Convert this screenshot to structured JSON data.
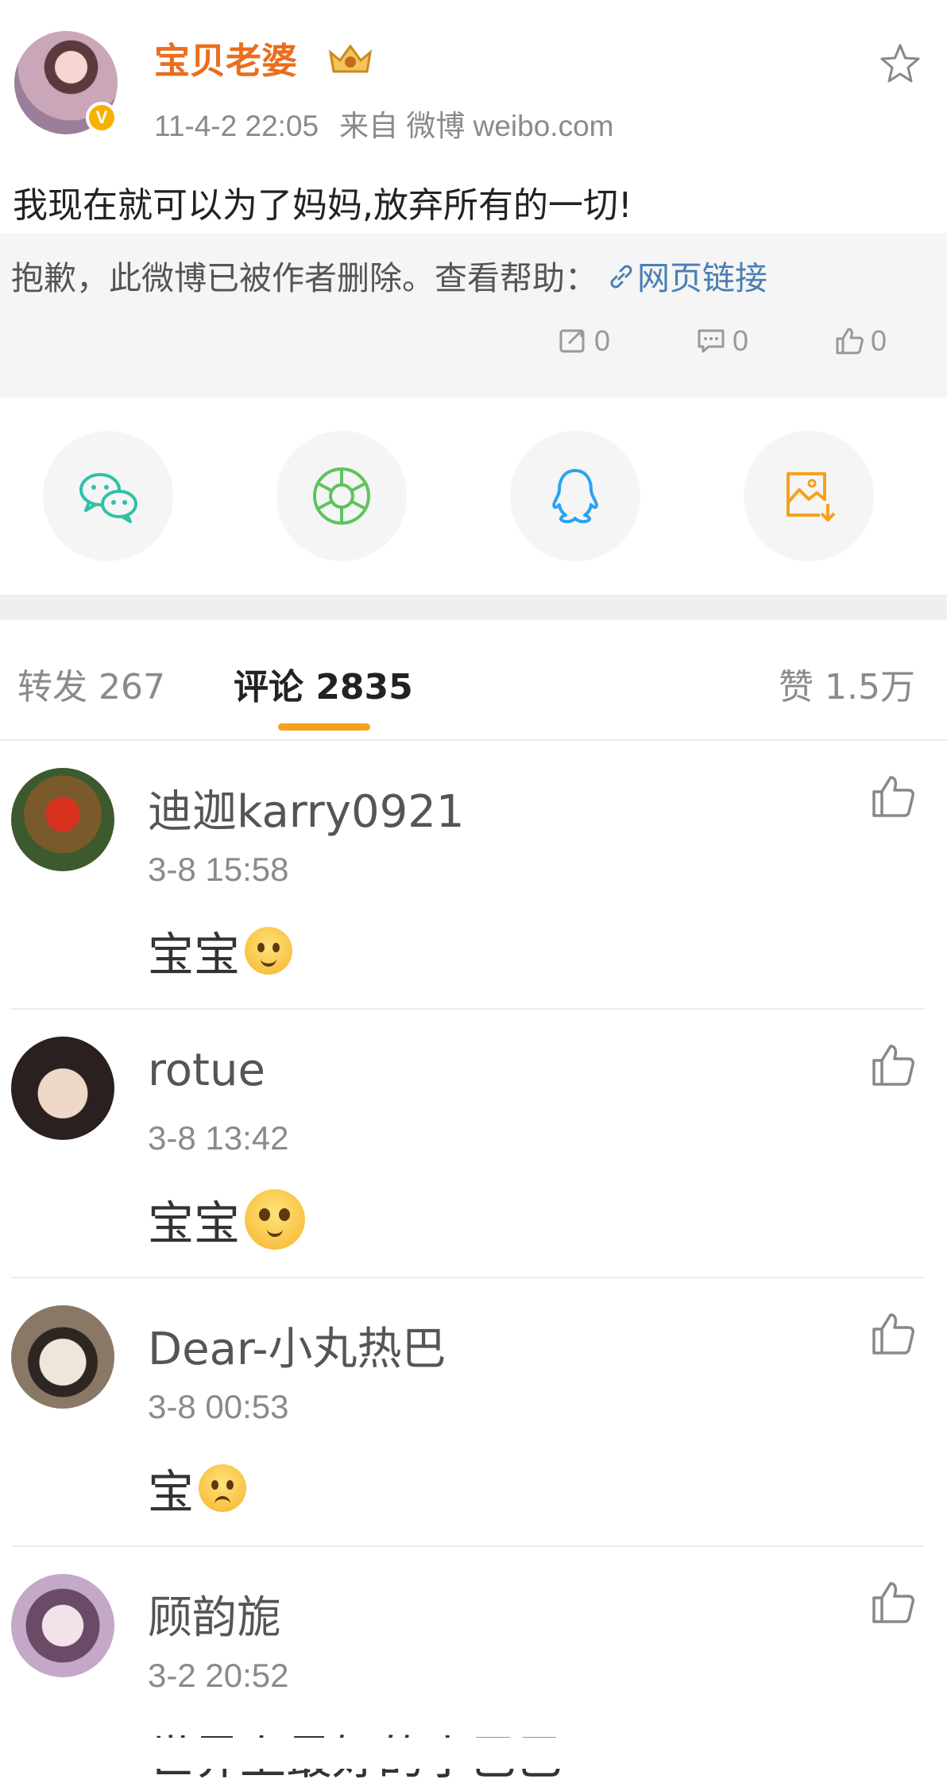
{
  "post": {
    "username": "宝贝老婆",
    "time": "11-4-2 22:05",
    "source": "来自 微博 weibo.com",
    "text": "我现在就可以为了妈妈,放弃所有的一切!",
    "deleted_notice": "抱歉，此微博已被作者删除。查看帮助：",
    "web_link": "网页链接",
    "repost_count": "0",
    "comment_count": "0",
    "like_count": "0"
  },
  "share": {
    "icons": [
      "wechat-icon",
      "moments-icon",
      "qq-icon",
      "save-image-icon"
    ],
    "colors": {
      "wechat": "#2ec1a8",
      "moments": "#5cc45c",
      "qq": "#2aa3f2",
      "save": "#f6a01a"
    }
  },
  "tabs": {
    "repost": "转发 267",
    "comment": "评论 2835",
    "like": "赞 1.5万"
  },
  "comments": [
    {
      "name": "迪迦karry0921",
      "time": "3-8 15:58",
      "text": "宝宝"
    },
    {
      "name": "rotue",
      "time": "3-8 13:42",
      "text": "宝宝"
    },
    {
      "name": "Dear-小丸热巴",
      "time": "3-8 00:53",
      "text": "宝"
    },
    {
      "name": "顾韵旎",
      "time": "3-2 20:52",
      "text": "世界上最好的小巴巴"
    }
  ],
  "colors": {
    "accent": "#ea6e1e",
    "link": "#4a7fb5",
    "tab_indicator": "#f6a01a"
  }
}
